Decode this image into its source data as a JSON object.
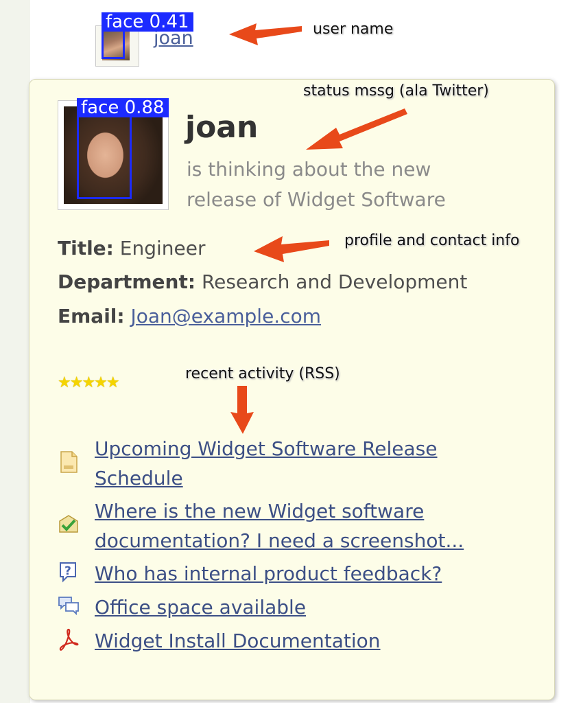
{
  "user": {
    "name": "joan"
  },
  "detections": [
    {
      "label": "face 0.41"
    },
    {
      "label": "face 0.88"
    }
  ],
  "profile": {
    "name": "joan",
    "status": "is thinking about the new release of Widget Software",
    "title_label": "Title:",
    "title_value": "Engineer",
    "department_label": "Department:",
    "department_value": "Research and Development",
    "email_label": "Email:",
    "email_value": "Joan@example.com",
    "rating_stars": "★★★★★",
    "rating": 5
  },
  "activity": [
    {
      "icon": "document-icon",
      "text": "Upcoming Widget Software Release Schedule"
    },
    {
      "icon": "check-envelope-icon",
      "text": "Where is the new Widget software documentation? I need a screenshot..."
    },
    {
      "icon": "question-icon",
      "text": "Who has internal product feedback?"
    },
    {
      "icon": "chat-bubbles-icon",
      "text": "Office space available"
    },
    {
      "icon": "pdf-icon",
      "text": "Widget Install Documentation"
    }
  ],
  "callouts": {
    "user_name": "user name",
    "status": "status mssg (ala Twitter)",
    "profile": "profile and contact info",
    "activity": "recent activity (RSS)"
  },
  "colors": {
    "card_bg": "#fdfde8",
    "link": "#3c4f85",
    "detection": "#1c2bff",
    "arrow": "#e8491a",
    "star": "#f5d400"
  }
}
